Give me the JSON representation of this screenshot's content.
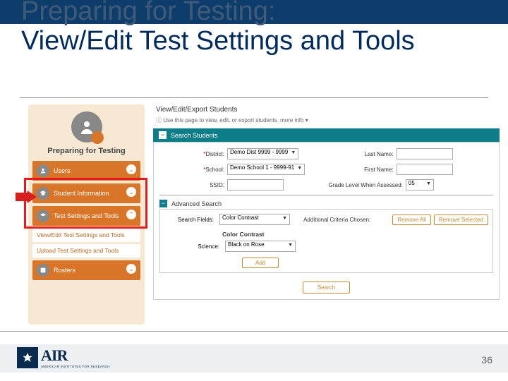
{
  "title": {
    "line1": "Preparing for Testing:",
    "line2": "View/Edit Test Settings and Tools"
  },
  "sidebar": {
    "heading": "Preparing for Testing",
    "items": [
      {
        "label": "Users",
        "open": false
      },
      {
        "label": "Student Information",
        "open": false
      },
      {
        "label": "Test Settings and Tools",
        "open": true,
        "subs": [
          "View/Edit Test Settings and Tools",
          "Upload Test Settings and Tools"
        ]
      },
      {
        "label": "Rosters",
        "open": false
      }
    ]
  },
  "main": {
    "panel_title": "View/Edit/Export Students",
    "info": "Use this page to view, edit, or export students.  more info ▾",
    "section_label": "Search Students",
    "form": {
      "district_label": "District:",
      "district_value": "Demo Dist 9999 - 9999",
      "lastname_label": "Last Name:",
      "school_label": "School:",
      "school_value": "Demo School 1 - 9999-91",
      "firstname_label": "First Name:",
      "ssid_label": "SSID:",
      "grade_label": "Grade Level When Assessed:",
      "grade_value": "05"
    },
    "advanced": {
      "title": "Advanced Search",
      "search_fields_label": "Search Fields:",
      "search_fields_value": "Color Contrast",
      "additional_label": "Additional Criteria Chosen:",
      "remove_all": "Remove All",
      "remove_selected": "Remove Selected",
      "group_title": "Color Contrast",
      "science_label": "Science:",
      "science_value": "Black on Rose",
      "add": "Add"
    },
    "search_btn": "Search"
  },
  "footer": {
    "logo_text": "AIR",
    "logo_sub": "AMERICAN INSTITUTES FOR RESEARCH",
    "page_number": "36"
  }
}
